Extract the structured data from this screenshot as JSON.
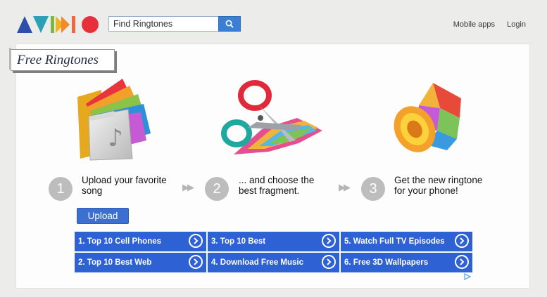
{
  "header": {
    "search_placeholder": "Find Ringtones",
    "nav": [
      "Mobile apps",
      "Login"
    ]
  },
  "main": {
    "title": "Free Ringtones",
    "steps": [
      {
        "number": "1",
        "text_line1": "Upload your favorite",
        "text_line2": "song"
      },
      {
        "number": "2",
        "text_line1": "... and choose the",
        "text_line2": "best fragment."
      },
      {
        "number": "3",
        "text_line1": "Get the new ringtone",
        "text_line2": "for your phone!"
      }
    ],
    "upload_label": "Upload"
  },
  "ad_links": [
    "1.  Top 10 Cell Phones",
    "3.  Top 10 Best",
    "5.  Watch Full TV Episodes",
    "2.  Top 10 Best Web",
    "4.  Download Free Music",
    "6.  Free 3D Wallpapers"
  ],
  "colors": {
    "accent": "#2e61d4",
    "button": "#3c6fd2",
    "search_button": "#3b7fd4",
    "background": "#ececea"
  }
}
